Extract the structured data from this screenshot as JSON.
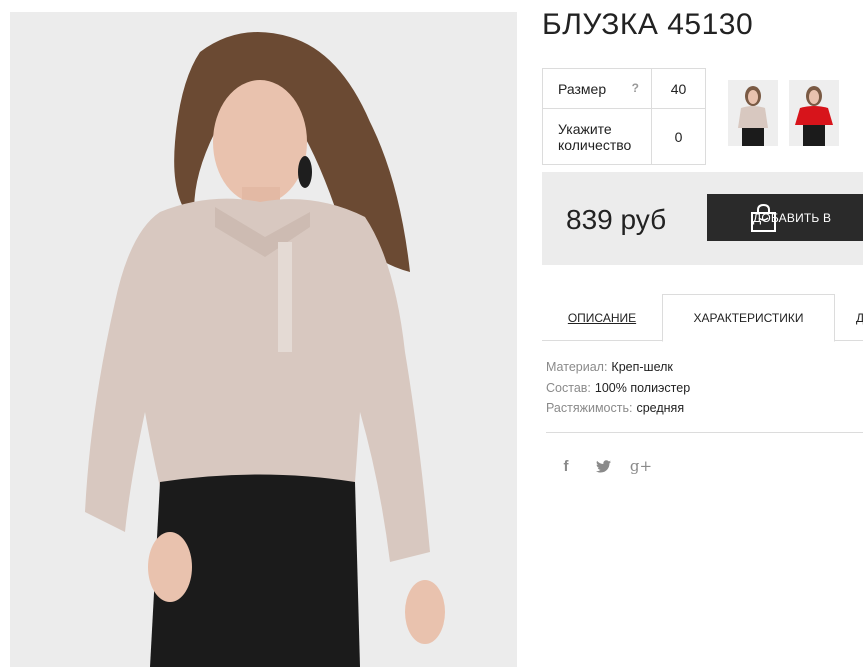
{
  "product": {
    "title": "БЛУЗКА 45130"
  },
  "options": {
    "size_label": "Размер",
    "size_help": "?",
    "size_value": "40",
    "qty_label": "Укажите количество",
    "qty_value": "0"
  },
  "thumbnails": [
    {
      "color_name": "beige",
      "color": "#d8c8c0"
    },
    {
      "color_name": "red",
      "color": "#d7141b"
    }
  ],
  "purchase": {
    "price": "839 руб",
    "add_to_cart_label": "ДОБАВИТЬ В"
  },
  "tabs": [
    {
      "label": "ОПИСАНИЕ"
    },
    {
      "label": "ХАРАКТЕРИСТИКИ"
    },
    {
      "label": "Д"
    }
  ],
  "specs": [
    {
      "key": "Материал:",
      "value": "Креп-шелк"
    },
    {
      "key": "Состав:",
      "value": "100% полиэстер"
    },
    {
      "key": "Растяжимость:",
      "value": "средняя"
    }
  ],
  "social": {
    "facebook": "f",
    "google": "g+"
  },
  "colors": {
    "blouse": "#d8c8c0",
    "dark_button": "#2a2a2a",
    "panel_bg": "#ececec"
  }
}
